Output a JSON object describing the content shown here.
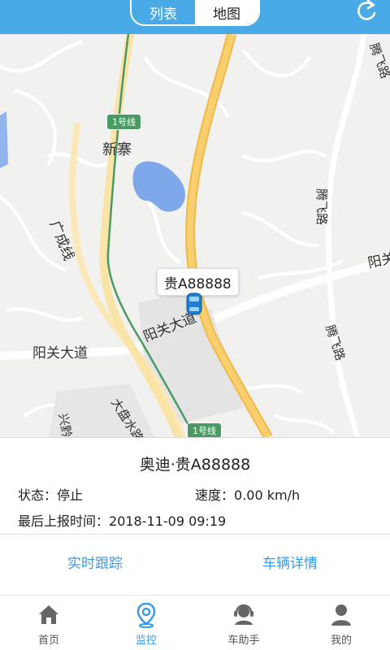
{
  "header": {
    "tabs": [
      {
        "label": "列表",
        "active": false
      },
      {
        "label": "地图",
        "active": true
      }
    ],
    "refresh_icon": "refresh-icon"
  },
  "map": {
    "car_plate_tag": "贵A88888",
    "car_icon": "car-icon",
    "labels": {
      "xinzhai": "新寨",
      "guangcheng": "广成线",
      "yangguan_main": "阳关大道",
      "yangguan_left": "阳关大道",
      "yangguan_right": "阳关",
      "tengfei_1": "腾飞路",
      "tengfei_2": "腾飞路",
      "tengfei_3": "腾飞路",
      "xingqian": "兴黔",
      "dapanshui": "大盘水路",
      "metro_1": "1号线",
      "metro_2": "1号线"
    }
  },
  "vehicle": {
    "name": "奥迪·贵A88888",
    "status_label": "状态：",
    "status_value": "停止",
    "speed_label": "速度：",
    "speed_value": "0.00 km/h",
    "report_label": "最后上报时间：",
    "report_value": "2018-11-09 09:19"
  },
  "actions": {
    "realtime_track": "实时跟踪",
    "vehicle_detail": "车辆详情"
  },
  "nav": {
    "items": [
      {
        "label": "首页",
        "icon": "home-icon",
        "active": false
      },
      {
        "label": "监控",
        "icon": "location-pin-icon",
        "active": true
      },
      {
        "label": "车助手",
        "icon": "headset-icon",
        "active": false
      },
      {
        "label": "我的",
        "icon": "user-icon",
        "active": false
      }
    ]
  },
  "colors": {
    "accent": "#4aaae8",
    "link": "#3a9be6",
    "metro_line": "#4c9a63",
    "highway": "#f7c65b"
  }
}
